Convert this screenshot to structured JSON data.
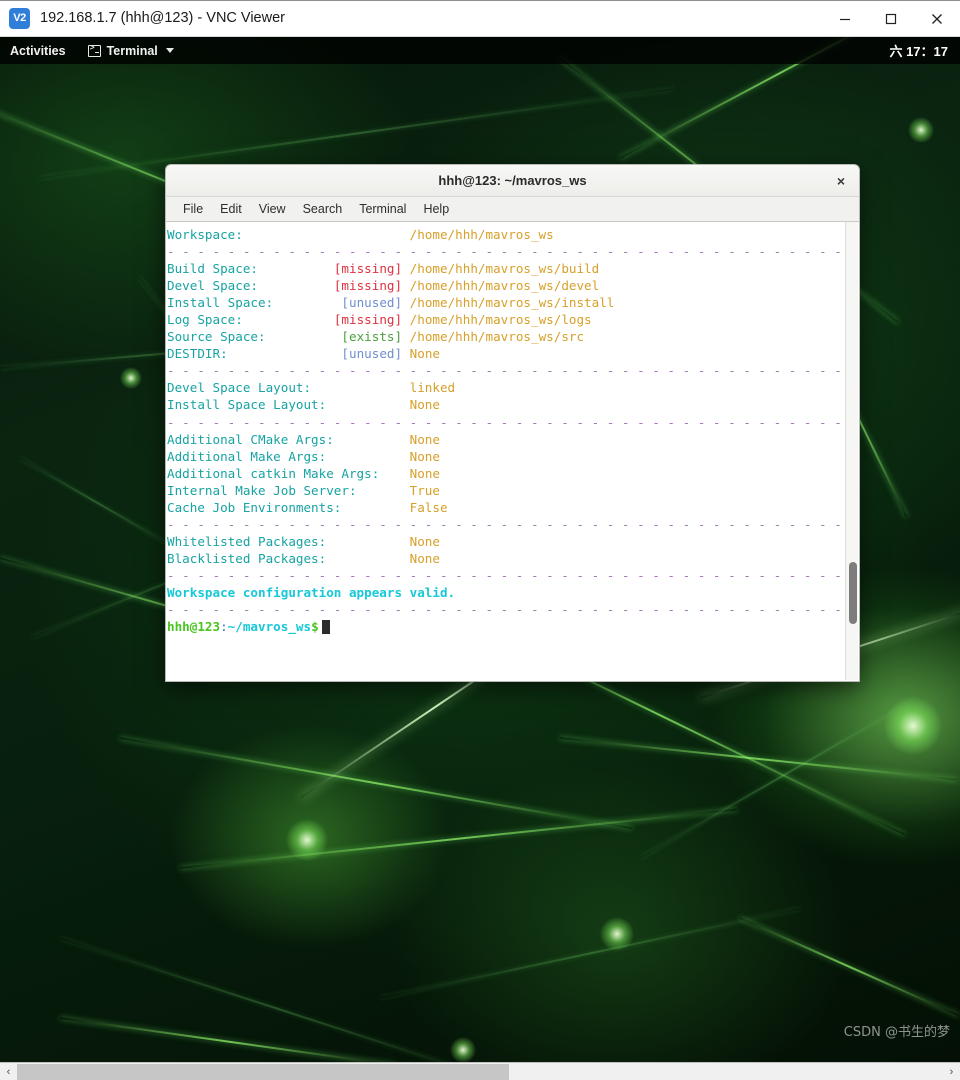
{
  "vnc_window": {
    "title": "192.168.1.7 (hhh@123) - VNC Viewer",
    "logo_text": "V2",
    "logo_icon": "vnc-logo-icon",
    "minimize_label": "minimize-icon",
    "maximize_label": "maximize-icon",
    "close_label": "close-icon"
  },
  "gnome_topbar": {
    "activities_label": "Activities",
    "app_menu_label": "Terminal",
    "app_icon": "terminal-icon",
    "dropdown_icon": "chevron-down-icon",
    "clock": "六 17：17"
  },
  "terminal_window": {
    "title": "hhh@123: ~/mavros_ws",
    "close_label": "×",
    "menus": [
      {
        "label": "File"
      },
      {
        "label": "Edit"
      },
      {
        "label": "View"
      },
      {
        "label": "Search"
      },
      {
        "label": "Terminal"
      },
      {
        "label": "Help"
      }
    ],
    "output_lines": [
      {
        "type": "kv",
        "label": "Workspace:",
        "status": "",
        "status_kind": "",
        "value": "/home/hhh/mavros_ws"
      },
      {
        "type": "sep"
      },
      {
        "type": "kv",
        "label": "Build Space:",
        "status": "[missing]",
        "status_kind": "missing",
        "value": "/home/hhh/mavros_ws/build"
      },
      {
        "type": "kv",
        "label": "Devel Space:",
        "status": "[missing]",
        "status_kind": "missing",
        "value": "/home/hhh/mavros_ws/devel"
      },
      {
        "type": "kv",
        "label": "Install Space:",
        "status": "[unused]",
        "status_kind": "unused",
        "value": "/home/hhh/mavros_ws/install"
      },
      {
        "type": "kv",
        "label": "Log Space:",
        "status": "[missing]",
        "status_kind": "missing",
        "value": "/home/hhh/mavros_ws/logs"
      },
      {
        "type": "kv",
        "label": "Source Space:",
        "status": "[exists]",
        "status_kind": "exists",
        "value": "/home/hhh/mavros_ws/src"
      },
      {
        "type": "kv",
        "label": "DESTDIR:",
        "status": "[unused]",
        "status_kind": "unused",
        "value": "None"
      },
      {
        "type": "sep"
      },
      {
        "type": "kv",
        "label": "Devel Space Layout:",
        "status": "",
        "status_kind": "",
        "value": "linked"
      },
      {
        "type": "kv",
        "label": "Install Space Layout:",
        "status": "",
        "status_kind": "",
        "value": "None"
      },
      {
        "type": "sep"
      },
      {
        "type": "kv",
        "label": "Additional CMake Args:",
        "status": "",
        "status_kind": "",
        "value": "None"
      },
      {
        "type": "kv",
        "label": "Additional Make Args:",
        "status": "",
        "status_kind": "",
        "value": "None"
      },
      {
        "type": "kv",
        "label": "Additional catkin Make Args:",
        "status": "",
        "status_kind": "",
        "value": "None"
      },
      {
        "type": "kv",
        "label": "Internal Make Job Server:",
        "status": "",
        "status_kind": "",
        "value": "True"
      },
      {
        "type": "kv",
        "label": "Cache Job Environments:",
        "status": "",
        "status_kind": "",
        "value": "False"
      },
      {
        "type": "sep"
      },
      {
        "type": "kv",
        "label": "Whitelisted Packages:",
        "status": "",
        "status_kind": "",
        "value": "None"
      },
      {
        "type": "kv",
        "label": "Blacklisted Packages:",
        "status": "",
        "status_kind": "",
        "value": "None"
      },
      {
        "type": "sep"
      },
      {
        "type": "valid",
        "text": "Workspace configuration appears valid."
      },
      {
        "type": "sep"
      }
    ],
    "prompt": {
      "user_host": "hhh@123",
      "separator": ":",
      "cwd": "~/mavros_ws",
      "symbol": "$",
      "input": ""
    },
    "scrollbar": {
      "name": "terminal-vertical-scrollbar"
    }
  },
  "bottom_scrollbar": {
    "left_arrow": "‹",
    "right_arrow": "›"
  },
  "watermark": {
    "text": "CSDN @书生的梦"
  },
  "colors": {
    "label": "#18a3a3",
    "path": "#d7a02a",
    "missing": "#e0313f",
    "unused": "#6f8fd0",
    "exists": "#4aa03c",
    "separator": "#a779b5",
    "valid": "#17c8d8",
    "prompt_user": "#49c421",
    "prompt_cwd": "#17c8d8",
    "terminal_bg": "#ffffff",
    "vnc_accent": "#2f7fd8",
    "wallpaper_green": "#0a2410"
  }
}
